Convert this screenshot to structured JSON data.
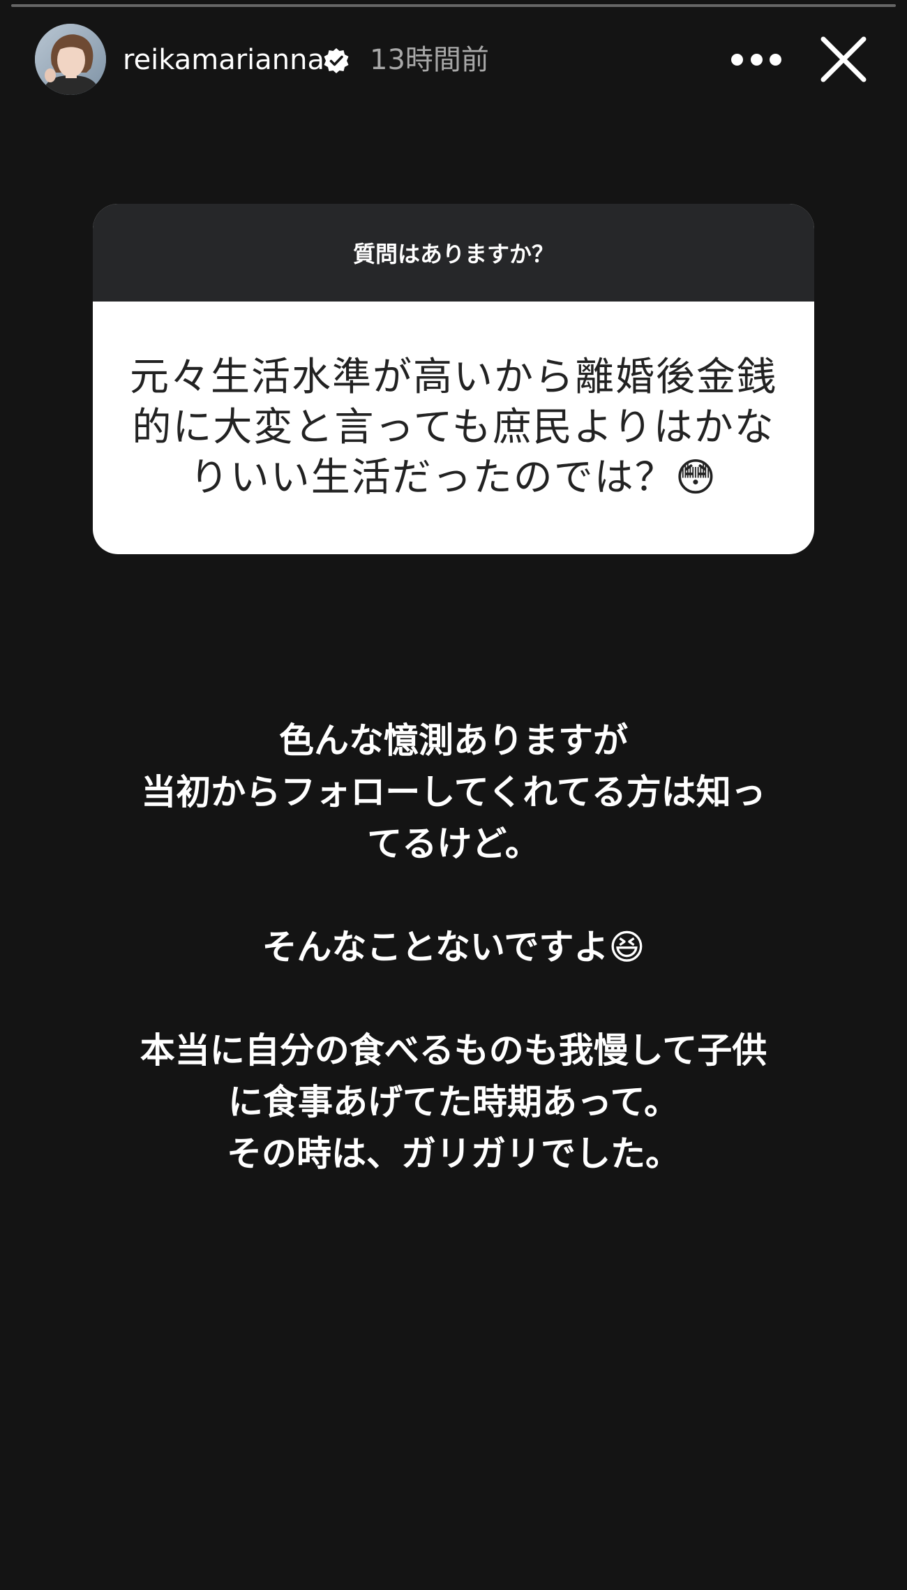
{
  "story": {
    "progress_fraction": 0.0
  },
  "header": {
    "username": "reikamarianna",
    "timestamp": "13時間前",
    "avatar_icon": "profile-photo",
    "verified_icon": "verified-badge-icon",
    "more_icon": "more-dots-icon",
    "close_icon": "close-x-icon"
  },
  "question_card": {
    "prompt": "質問はありますか？",
    "question": "元々生活水準が高いから離婚後金銭\n的に大変と言っても庶民よりはかな\nりいい生活だったのでは？😳"
  },
  "answer": {
    "paragraph_1": "色んな憶測ありますが\n当初からフォローしてくれてる方は知っ\nてるけど。",
    "paragraph_2": "そんなことないですよ😆",
    "paragraph_3": "本当に自分の食べるものも我慢して子供\nに食事あげてた時期あって。\nその時は、ガリガリでした。"
  },
  "colors": {
    "background": "#141414",
    "card_header": "#262729",
    "card_body": "#ffffff",
    "question_text": "#222222",
    "timestamp": "#a8a8a8"
  }
}
